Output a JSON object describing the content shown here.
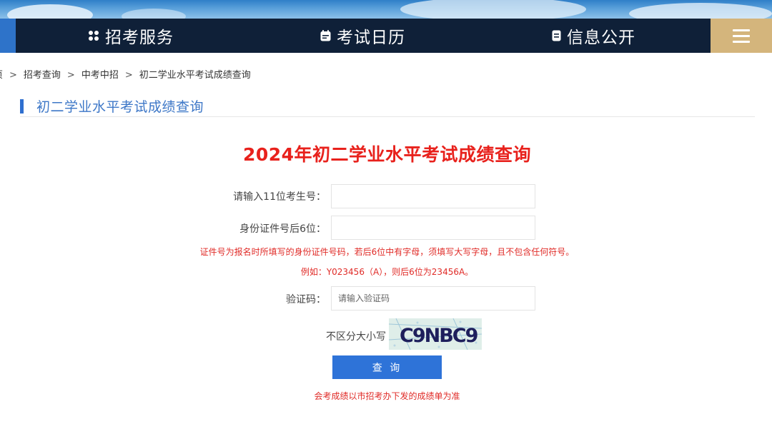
{
  "nav": {
    "items": [
      {
        "label": "招考服务",
        "icon": "grid-icon"
      },
      {
        "label": "考试日历",
        "icon": "calendar-icon"
      },
      {
        "label": "信息公开",
        "icon": "document-icon"
      }
    ],
    "menu_icon": "menu-icon"
  },
  "breadcrumb": {
    "items": [
      "首页",
      "招考查询",
      "中考中招",
      "初二学业水平考试成绩查询"
    ],
    "separator": ">"
  },
  "section": {
    "title": "初二学业水平考试成绩查询"
  },
  "form": {
    "title": "2024年初二学业水平考试成绩查询",
    "exam_no_label": "请输入11位考生号：",
    "exam_no_value": "",
    "id_label": "身份证件号后6位：",
    "id_value": "",
    "note_1": "证件号为报名时所填写的身份证件号码，若后6位中有字母，须填写大写字母，且不包含任何符号。",
    "note_2": "例如：Y023456（A），则后6位为23456A。",
    "captcha_label": "验证码：",
    "captcha_placeholder": "请输入验证码",
    "case_hint": "不区分大小写",
    "captcha_text": "C9NBC9",
    "submit_label": "查 询",
    "footer_note": "会考成绩以市招考办下发的成绩单为准"
  },
  "colors": {
    "nav_bg": "#0f2038",
    "menu_bg": "#d4b57c",
    "accent_blue": "#2e73d8",
    "title_red": "#e8211c",
    "note_red": "#e02b27"
  }
}
